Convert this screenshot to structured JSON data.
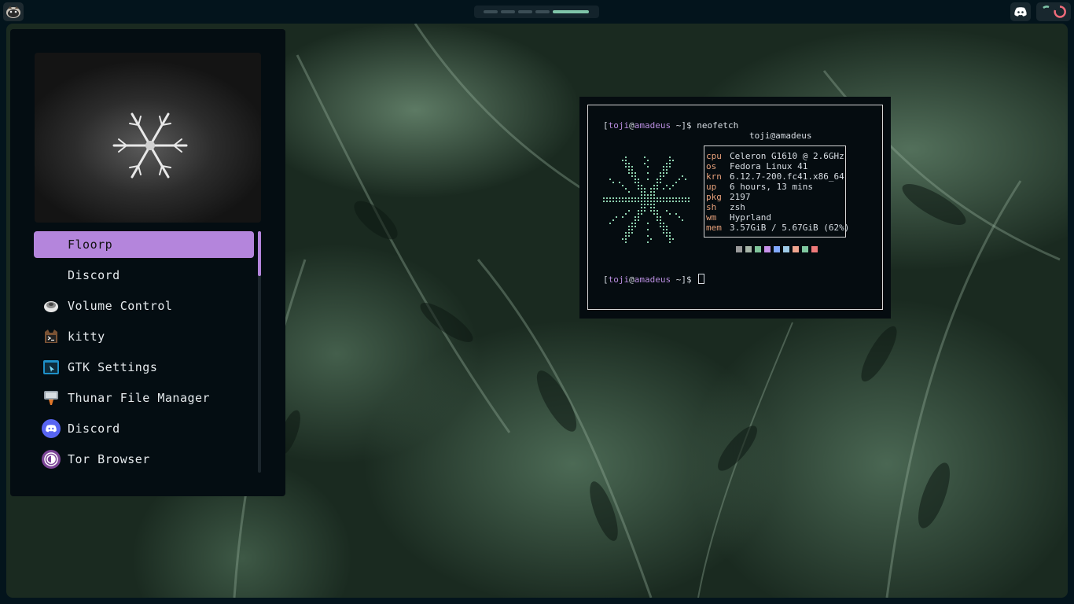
{
  "topbar": {
    "workspaces": [
      {
        "active": false
      },
      {
        "active": false
      },
      {
        "active": false
      },
      {
        "active": false
      },
      {
        "active": true
      }
    ]
  },
  "launcher": {
    "items": [
      {
        "label": "Floorp",
        "icon": "floorp-icon",
        "selected": true
      },
      {
        "label": "Discord",
        "icon": "discord-icon",
        "selected": false
      },
      {
        "label": "Volume Control",
        "icon": "volume-control-icon",
        "selected": false
      },
      {
        "label": "kitty",
        "icon": "kitty-icon",
        "selected": false
      },
      {
        "label": "GTK Settings",
        "icon": "gtk-settings-icon",
        "selected": false
      },
      {
        "label": "Thunar File Manager",
        "icon": "thunar-icon",
        "selected": false
      },
      {
        "label": "Discord",
        "icon": "discord-icon",
        "selected": false
      },
      {
        "label": "Tor Browser",
        "icon": "tor-browser-icon",
        "selected": false
      }
    ]
  },
  "terminal": {
    "prompt1": {
      "open": "[",
      "user": "toji",
      "at": "@",
      "host": "amadeus",
      "rest": " ~]$ ",
      "command": "neofetch"
    },
    "title": "toji@amadeus",
    "info": [
      {
        "key": "cpu",
        "value": "Celeron G1610 @ 2.6GHz"
      },
      {
        "key": "os",
        "value": "Fedora Linux 41"
      },
      {
        "key": "krn",
        "value": "6.12.7-200.fc41.x86_64"
      },
      {
        "key": "up",
        "value": "6 hours, 13 mins"
      },
      {
        "key": "pkg",
        "value": "2197"
      },
      {
        "key": "sh",
        "value": "zsh"
      },
      {
        "key": "wm",
        "value": "Hyprland"
      },
      {
        "key": "mem",
        "value": "3.57GiB / 5.67GiB (62%)"
      }
    ],
    "palette": [
      "#9a9a9a",
      "#a7b5a8",
      "#7fc49a",
      "#c792ea",
      "#82aaff",
      "#9ecbe8",
      "#f0a58f",
      "#80c8a0",
      "#ef7a7a"
    ],
    "prompt2": {
      "open": "[",
      "user": "toji",
      "at": "@",
      "host": "amadeus",
      "rest": " ~]$ "
    }
  },
  "colors": {
    "accent": "#b485dc",
    "panel_bg": "#040d12",
    "workspace_active": "#7fc4a8",
    "info_key": "#e6a07a"
  }
}
